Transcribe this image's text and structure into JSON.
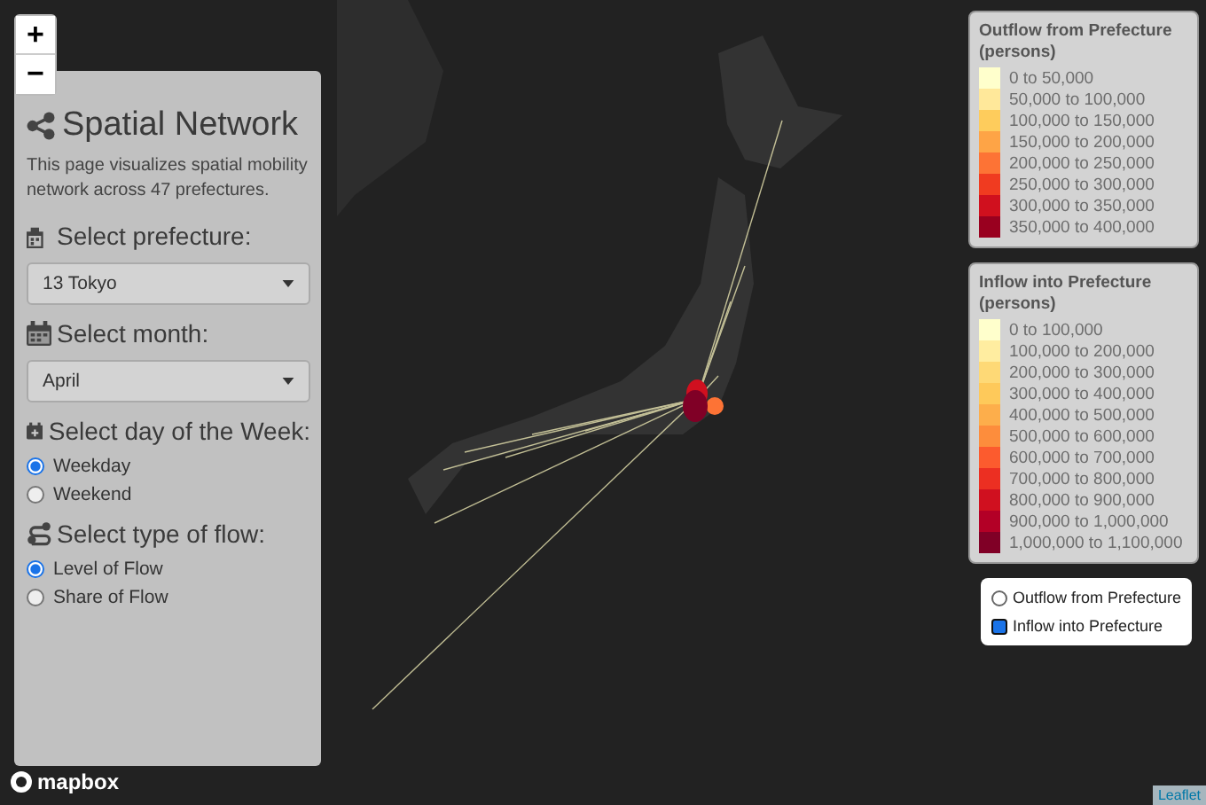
{
  "zoom_controls": [
    "+",
    "−"
  ],
  "panel": {
    "title": "Spatial Network",
    "description": "This page visualizes spatial mobility network across 47 prefectures.",
    "sections": [
      {
        "kind": "select",
        "label": "Select prefecture:",
        "value": "13 Tokyo"
      },
      {
        "kind": "select",
        "label": "Select month:",
        "value": "April"
      },
      {
        "kind": "radio",
        "label": "Select day of the Week:",
        "options": [
          {
            "label": "Weekday",
            "selected": true
          },
          {
            "label": "Weekend",
            "selected": false
          }
        ]
      },
      {
        "kind": "radio",
        "label": "Select type of flow:",
        "options": [
          {
            "label": "Level of Flow",
            "selected": true
          },
          {
            "label": "Share of Flow",
            "selected": false
          }
        ]
      }
    ]
  },
  "legends": [
    {
      "title": "Outflow from Prefecture (persons)",
      "items": [
        {
          "label": "0 to 50,000",
          "color": "#ffffcc"
        },
        {
          "label": "50,000 to 100,000",
          "color": "#ffe89a"
        },
        {
          "label": "100,000 to 150,000",
          "color": "#fecc5c"
        },
        {
          "label": "150,000 to 200,000",
          "color": "#fea446"
        },
        {
          "label": "200,000 to 250,000",
          "color": "#fd7335"
        },
        {
          "label": "250,000 to 300,000",
          "color": "#f03b20"
        },
        {
          "label": "300,000 to 350,000",
          "color": "#d0101e"
        },
        {
          "label": "350,000 to 400,000",
          "color": "#99001f"
        }
      ]
    },
    {
      "title": "Inflow into Prefecture (persons)",
      "items": [
        {
          "label": "0 to 100,000",
          "color": "#ffffcc"
        },
        {
          "label": "100,000 to 200,000",
          "color": "#ffeda0"
        },
        {
          "label": "200,000 to 300,000",
          "color": "#fed976"
        },
        {
          "label": "300,000 to 400,000",
          "color": "#fec95a"
        },
        {
          "label": "400,000 to 500,000",
          "color": "#fdae4b"
        },
        {
          "label": "500,000 to 600,000",
          "color": "#fd8d3c"
        },
        {
          "label": "600,000 to 700,000",
          "color": "#fc5b2e"
        },
        {
          "label": "700,000 to 800,000",
          "color": "#ec2f22"
        },
        {
          "label": "800,000 to 900,000",
          "color": "#d0101f"
        },
        {
          "label": "900,000 to 1,000,000",
          "color": "#b30026"
        },
        {
          "label": "1,000,000 to 1,100,000",
          "color": "#800026"
        }
      ]
    }
  ],
  "layer_control": {
    "options": [
      {
        "label": "Outflow from Prefecture",
        "selected": false
      },
      {
        "label": "Inflow into Prefecture",
        "selected": true
      }
    ]
  },
  "logo": "mapbox",
  "attribution": "Leaflet"
}
